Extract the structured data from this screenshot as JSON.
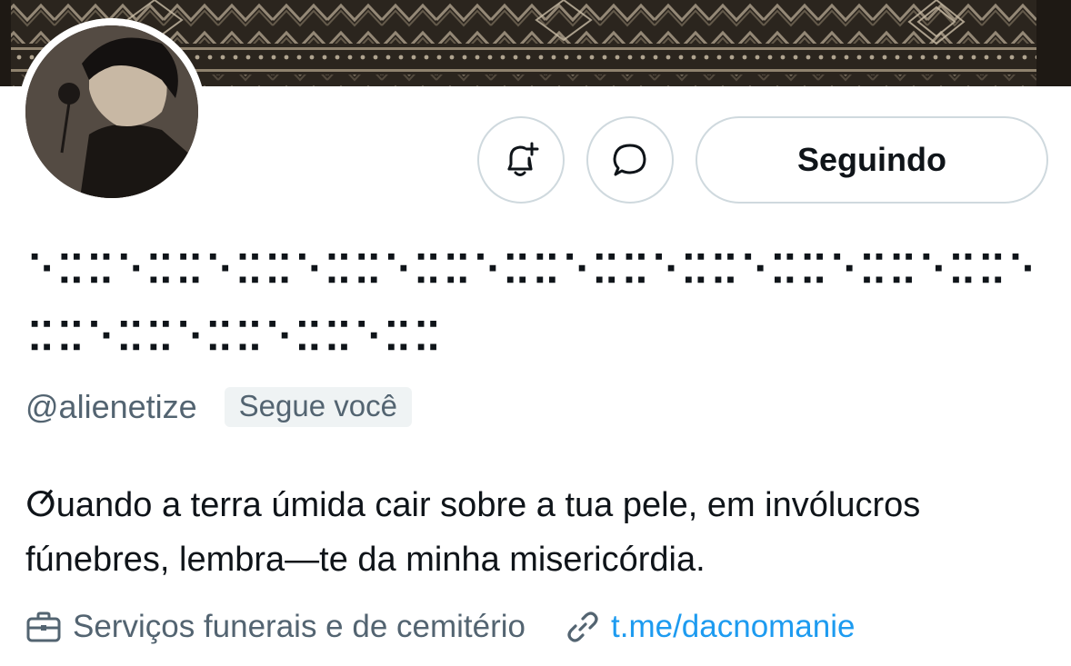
{
  "profile": {
    "display_name": "⠑⠭⠭⠑⠭⠭⠑⠭⠭⠑⠭⠭⠑⠭⠭⠑⠭⠭⠑⠭⠭⠑⠭⠭⠑⠭⠭⠑⠭⠭⠑⠭⠭⠑⠭⠭⠑⠭⠭⠑⠭⠭⠑⠭⠭⠑⠭⠭",
    "handle": "@alienetize",
    "follows_you_badge": "Segue você",
    "bio": "ⵚuando a terra úmida cair sobre a tua pele, em invólucros fúnebres, lembra—te da minha misericórdia.",
    "category": "Serviços funerais e de cemitério",
    "link": "t.me/dacnomanie"
  },
  "actions": {
    "notify_icon": "bell-plus-icon",
    "message_icon": "message-bubble-icon",
    "follow_label": "Seguindo"
  },
  "colors": {
    "text_primary": "#0f1419",
    "text_secondary": "#536471",
    "link": "#1d9bf0",
    "border": "#cfd9de",
    "badge_bg": "#eff3f4"
  }
}
